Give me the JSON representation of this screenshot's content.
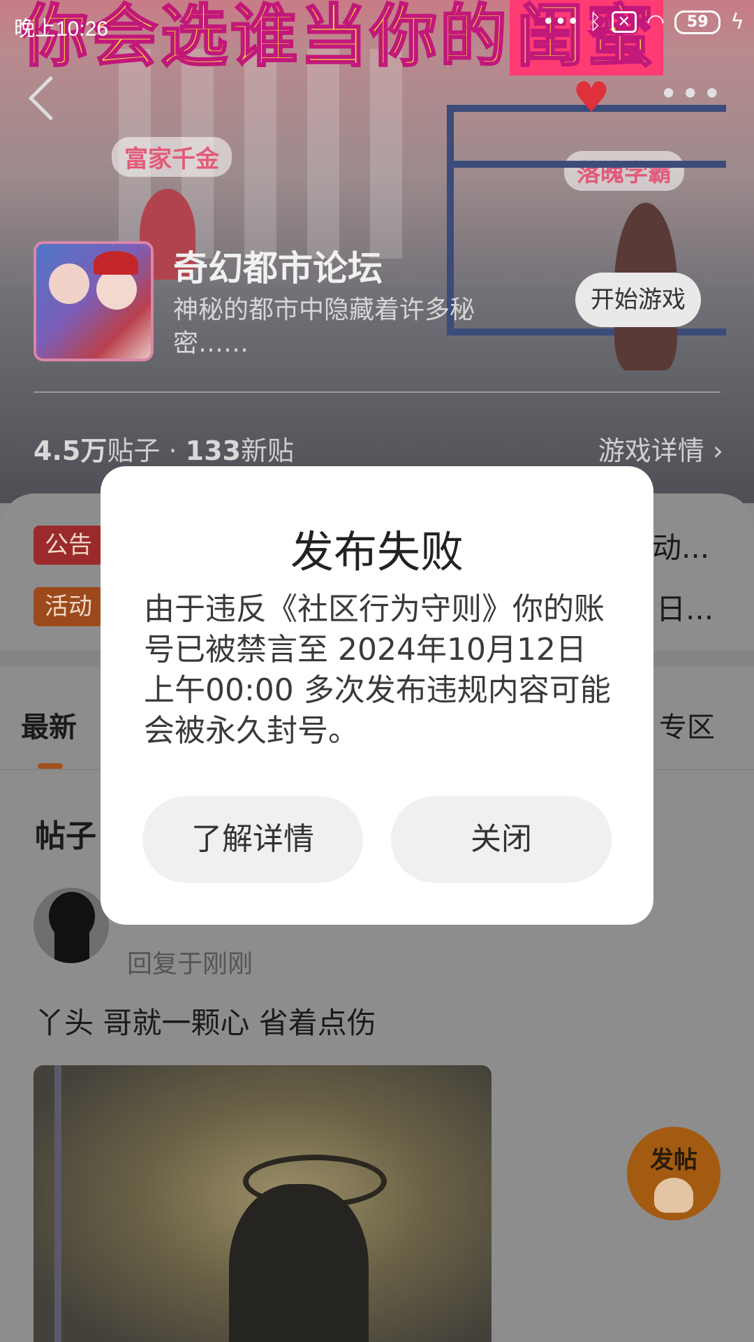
{
  "status_bar": {
    "time": "晚上10:26",
    "battery": "59"
  },
  "banner": {
    "headline": "你会选谁当你的",
    "headline_highlight": "闺蜜",
    "left_tag": "富家千金",
    "right_tag": "落魄学霸"
  },
  "game": {
    "name": "奇幻都市论坛",
    "description": "神秘的都市中隐藏着许多秘密……",
    "start_button": "开始游戏",
    "stats_posts_count": "4.5万",
    "stats_posts_label": "贴子",
    "stats_dot": "·",
    "stats_new_count": "133",
    "stats_new_label": "新贴",
    "details_link": "游戏详情"
  },
  "notices": [
    {
      "tag": "公告",
      "text_tail": "动..."
    },
    {
      "tag": "活动",
      "text_tail": "日..."
    }
  ],
  "tabs": {
    "latest": "最新",
    "right_partial": "专区"
  },
  "feed": {
    "section_title": "帖子",
    "post": {
      "reply_time": "回复于刚刚",
      "text": "丫头 哥就一颗心 省着点伤"
    },
    "fab_label": "发帖"
  },
  "dialog": {
    "title": "发布失败",
    "message": "由于违反《社区行为守则》你的账号已被禁言至 2024年10月12日 上午00:00 多次发布违规内容可能会被永久封号。",
    "learn_more": "了解详情",
    "close": "关闭"
  },
  "colors": {
    "notice_tag": "#9a2a2c",
    "activity_tag": "#9c4a1b",
    "heart": "#e0303a",
    "tab_underline": "#a0521e"
  }
}
